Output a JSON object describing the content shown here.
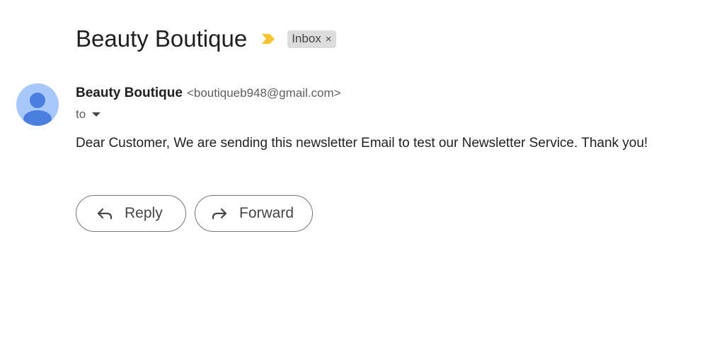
{
  "message": {
    "subject": "Beauty Boutique",
    "label": "Inbox",
    "label_remove": "×",
    "sender_name": "Beauty Boutique",
    "sender_email": "<boutiqueb948@gmail.com>",
    "to_label": "to",
    "body": "Dear Customer, We are sending this newsletter Email to test our Newsletter Service. Thank you!"
  },
  "actions": {
    "reply_label": "Reply",
    "forward_label": "Forward"
  },
  "icons": {
    "importance": "importance-marker-icon",
    "avatar": "person-icon",
    "reply": "reply-arrow-icon",
    "forward": "forward-arrow-icon"
  },
  "colors": {
    "importance_yellow": "#f4c430",
    "avatar_bg": "#a8c7fa",
    "avatar_fg": "#4a7fe0",
    "label_chip_bg": "#dddddd"
  }
}
